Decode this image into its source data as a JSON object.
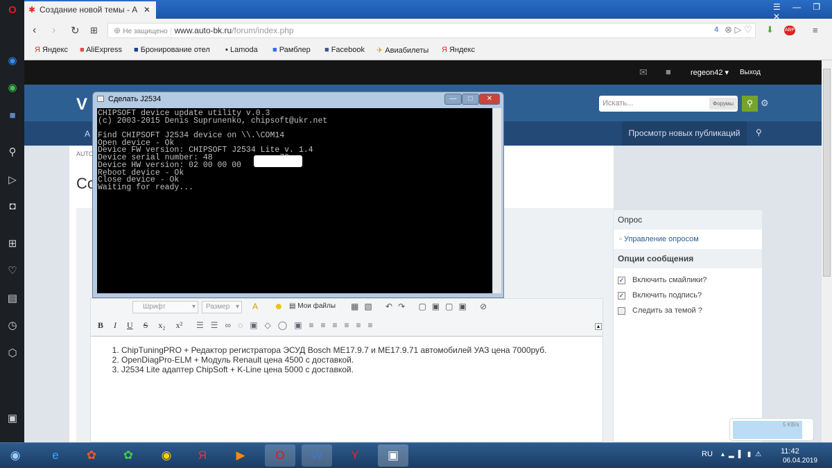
{
  "browser": {
    "tab_title": "Создание новой темы - A",
    "security": "Не защищено",
    "url_host": "www.auto-bk.ru",
    "url_path": "/forum/index.php",
    "badge_count": "4",
    "bookmarks": [
      "Яндекс",
      "AliExpress",
      "Бронирование отел",
      "Lamoda",
      "Рамблер",
      "Facebook",
      "Авиабилеты",
      "Яндекс"
    ]
  },
  "forum": {
    "username": "regeon42",
    "logout": "Выход",
    "search_placeholder": "Искать...",
    "search_scope": "Форумы",
    "nav_new": "Просмотр новых публикаций",
    "nav_partial": "A",
    "breadcrumb_partial": "AUTO",
    "title_partial": "Co",
    "toolbar": {
      "font": "Шрифт",
      "size": "Размер",
      "my_files": "Мои файлы",
      "bold": "B",
      "italic": "I",
      "underline": "U",
      "strike": "S",
      "sub": "x₂",
      "sup": "x²"
    },
    "editor_items": [
      "ChipTuningPRO + Редактор регистратора ЭСУД Bosch ME17.9.7 и ME17.9.71 автомобилей УАЗ цена 7000руб.",
      "OpenDiagPro-ELM + Модуль Renault цена 4500 с доставкой.",
      "J2534 Lite адаптер ChipSoft + K-Line цена 5000 с доставкой."
    ],
    "sidebar": {
      "poll_header": "Опрос",
      "poll_manage": "Управление опросом",
      "options_header": "Опции сообщения",
      "options": [
        {
          "label": "Включить смайлики?",
          "checked": true
        },
        {
          "label": "Включить подпись?",
          "checked": true
        },
        {
          "label": "Следить за темой ?",
          "checked": false
        }
      ]
    }
  },
  "console": {
    "title": "Сделать  J2534",
    "lines": [
      "CHIPSOFT device update utility v.0.3",
      "(c) 2003-2015 Denis Suprunenko, chipsoft@ukr.net",
      "",
      "Find CHIPSOFT J2534 device on \\\\.\\COM14",
      "Open device - Ok",
      "Device FW version: CHIPSOFT J2534 Lite v. 1.4",
      "Device serial number: 48              70",
      "Device HW version: 02 00 00 00",
      "Reboot device - Ok",
      "Close device - Ok",
      "Waiting for ready..."
    ]
  },
  "download": {
    "speed": "5 KB/s"
  },
  "taskbar": {
    "lang": "RU",
    "time": "11:42",
    "date": "06.04.2019"
  }
}
